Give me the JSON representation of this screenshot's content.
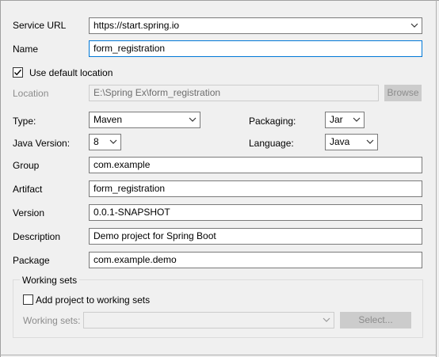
{
  "form": {
    "service_url": {
      "label": "Service URL",
      "value": "https://start.spring.io"
    },
    "name": {
      "label": "Name",
      "value": "form_registration"
    },
    "use_default_location": {
      "label": "Use default location",
      "checked": true
    },
    "location": {
      "label": "Location",
      "value": "E:\\Spring Ex\\form_registration",
      "browse_label": "Browse"
    },
    "type": {
      "label": "Type:",
      "value": "Maven"
    },
    "packaging": {
      "label": "Packaging:",
      "value": "Jar"
    },
    "java_version": {
      "label": "Java Version:",
      "value": "8"
    },
    "language": {
      "label": "Language:",
      "value": "Java"
    },
    "group": {
      "label": "Group",
      "value": "com.example"
    },
    "artifact": {
      "label": "Artifact",
      "value": "form_registration"
    },
    "version": {
      "label": "Version",
      "value": "0.0.1-SNAPSHOT"
    },
    "description": {
      "label": "Description",
      "value": "Demo project for Spring Boot"
    },
    "package": {
      "label": "Package",
      "value": "com.example.demo"
    }
  },
  "working_sets": {
    "title": "Working sets",
    "add_label": "Add project to working sets",
    "add_checked": false,
    "sets_label": "Working sets:",
    "sets_value": "",
    "select_label": "Select..."
  },
  "colors": {
    "focus_border": "#0078d7",
    "disabled_text": "#8c8c8c"
  },
  "icons": [
    "chevron-down-icon",
    "checkmark-icon"
  ]
}
